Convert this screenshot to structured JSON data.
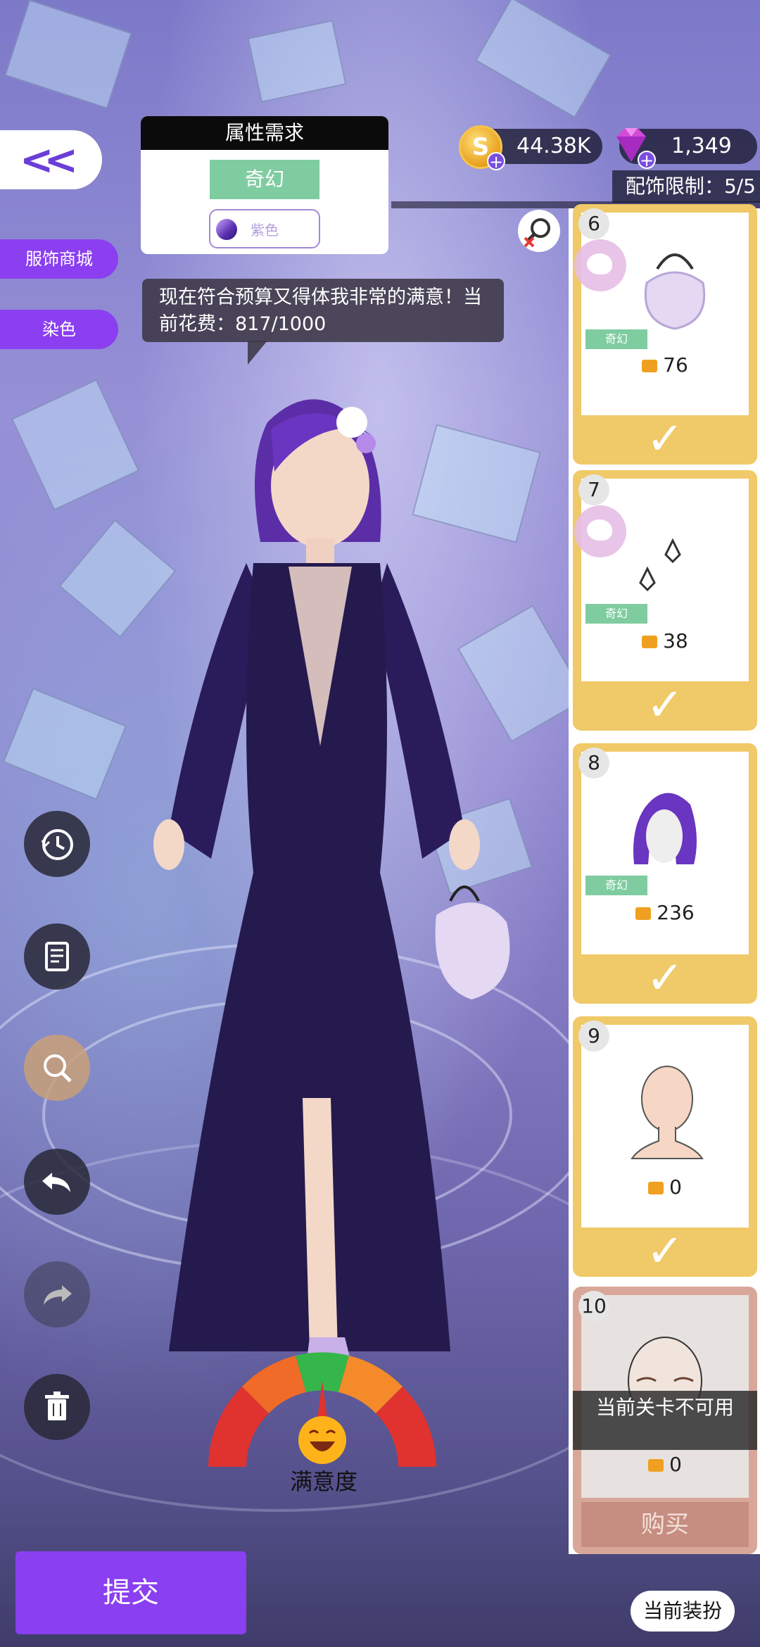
{
  "top_bar": {
    "coins": "44.38K",
    "gems": "1,349",
    "accessory_limit_label": "配饰限制：",
    "accessory_limit_value": "5/5"
  },
  "attribute_panel": {
    "title": "属性需求",
    "style_tag": "奇幻",
    "color_tag": "紫色"
  },
  "side_tabs": {
    "shop": "服饰商城",
    "dye": "染色"
  },
  "speech": {
    "text": "现在符合预算又得体我非常的满意！当前花费：817/1000"
  },
  "items": [
    {
      "num": "6",
      "tag": "奇幻",
      "price": "76"
    },
    {
      "num": "7",
      "tag": "奇幻",
      "price": "38"
    },
    {
      "num": "8",
      "tag": "奇幻",
      "price": "236"
    },
    {
      "num": "9",
      "price": "0"
    },
    {
      "num": "10",
      "price": "0",
      "unavailable": "当前关卡不可用",
      "buy": "购买"
    }
  ],
  "satisfaction": {
    "label": "满意度",
    "level": 0.5
  },
  "buttons": {
    "submit": "提交",
    "current_outfit": "当前装扮"
  },
  "colors": {
    "accent_purple": "#8a3ff0",
    "tag_green": "#7fcca0",
    "card_gold": "#f0c968"
  }
}
